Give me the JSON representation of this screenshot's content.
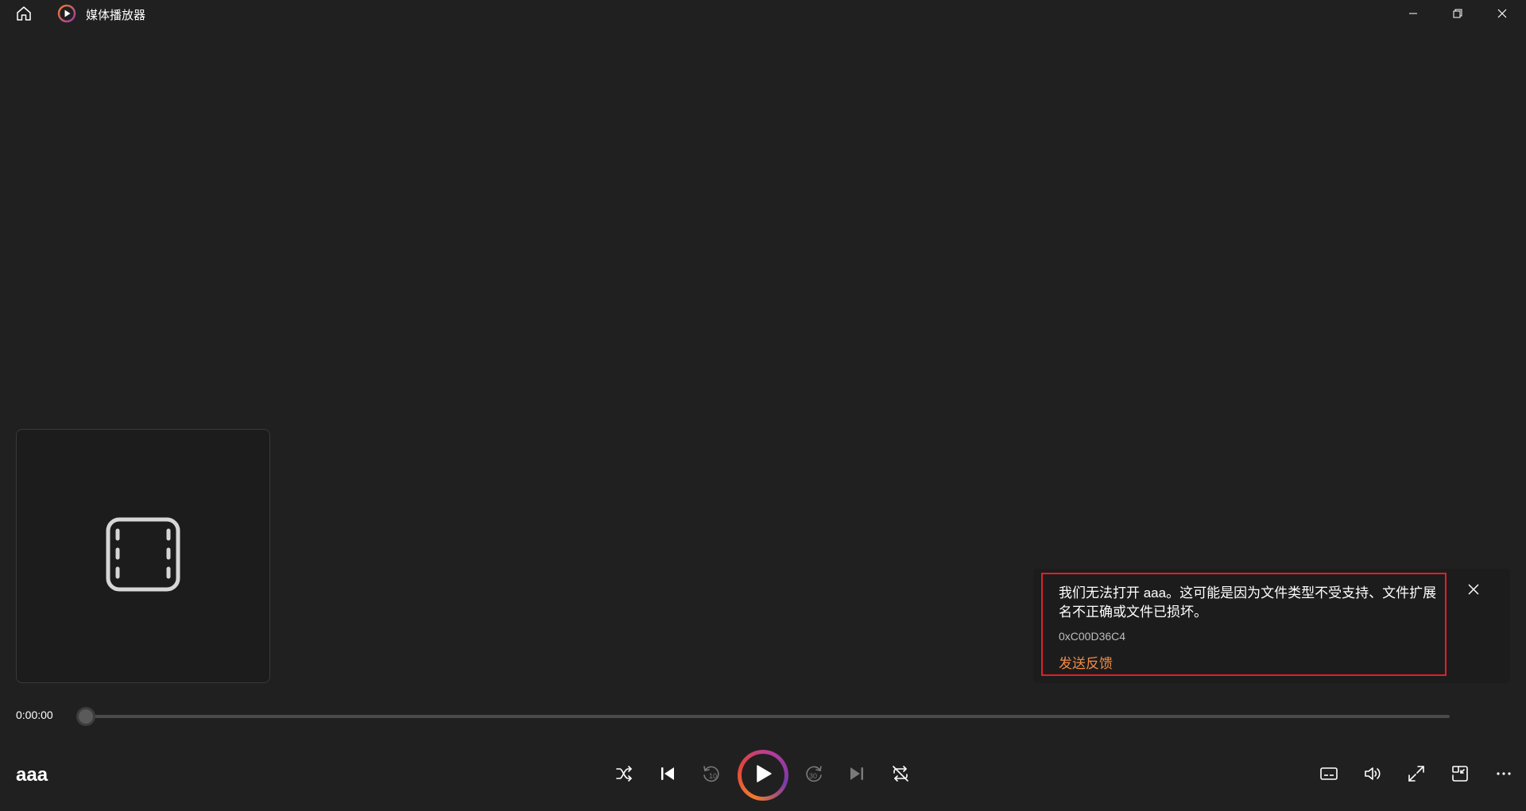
{
  "app": {
    "title": "媒体播放器",
    "icons": {
      "home": "home-icon",
      "logo": "media-player-logo",
      "minimize": "minimize-icon",
      "restore": "restore-icon",
      "close": "close-icon"
    }
  },
  "thumbnail": {
    "icon": "film-icon"
  },
  "error_toast": {
    "message": "我们无法打开 aaa。这可能是因为文件类型不受支持、文件扩展名不正确或文件已损坏。",
    "code": "0xC00D36C4",
    "link": "发送反馈",
    "accent_color": "#f08a45",
    "highlight_color": "#e0202a"
  },
  "player": {
    "time": "0:00:00",
    "progress": 0,
    "title": "aaa",
    "controls": [
      "shuffle-icon",
      "previous-icon",
      "rewind-10-icon",
      "play-icon",
      "forward-30-icon",
      "next-icon",
      "repeat-icon"
    ],
    "skip_back_label": "10",
    "skip_forward_label": "30",
    "right_controls": [
      "subtitles-icon",
      "volume-icon",
      "fullscreen-icon",
      "mini-player-icon",
      "more-icon"
    ]
  }
}
